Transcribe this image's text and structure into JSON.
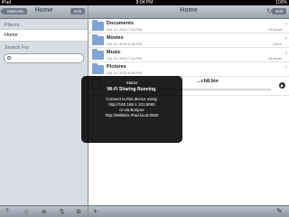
{
  "status": {
    "device": "iPad",
    "time": "8:04 PM",
    "battery": "100%"
  },
  "left_nav": {
    "back_label": "MyBooks",
    "title": "Home",
    "edit_label": "Edit"
  },
  "places": {
    "header": "Places",
    "items": [
      {
        "label": "Home"
      }
    ]
  },
  "search": {
    "header": "Search For",
    "placeholder": ""
  },
  "right_nav": {
    "title": "Home",
    "edit_label": "Edit"
  },
  "files": [
    {
      "name": "Documents",
      "date": "Oct 13, 2010 7:25 PM",
      "count": "13 items",
      "kind": "folder"
    },
    {
      "name": "Movies",
      "date": "Oct 13, 2010 6:36 PM",
      "count": "1 item",
      "kind": "folder"
    },
    {
      "name": "Music",
      "date": "Oct 13, 2010 7:44 PM",
      "count": "45 items",
      "kind": "folder"
    },
    {
      "name": "Pictures",
      "date": "Oct 13, 2010 6:45 PM",
      "count": "",
      "kind": "folder"
    },
    {
      "name": "...ch8.bin",
      "date": "",
      "count": "",
      "kind": "file",
      "progress": 0.12
    }
  ],
  "hud": {
    "title": "Status",
    "subtitle": "Wi-Fi Sharing Running.",
    "lines": [
      "Connect to this device using:",
      "http://192.168.1.101:8080",
      "or via Bonjour",
      "http://MiltiMin-iPad.local:8080"
    ]
  },
  "toolbar_left": {
    "help": "?",
    "wifi": "⌔",
    "share": "⊚",
    "sync": "⇅",
    "settings": "⚙"
  },
  "toolbar_right": {
    "add": "+",
    "edit_icon": "✎"
  }
}
